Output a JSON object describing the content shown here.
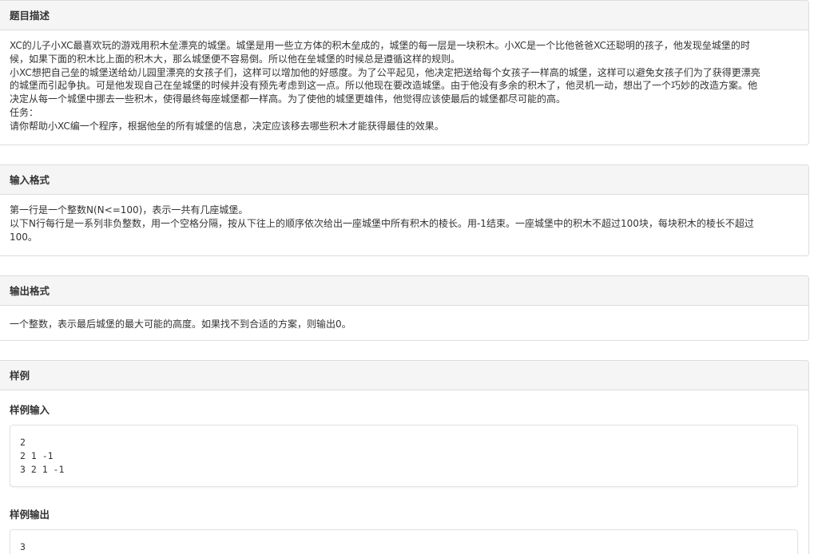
{
  "description": {
    "heading": "题目描述",
    "lines": [
      "XC的儿子小XC最喜欢玩的游戏用积木垒漂亮的城堡。城堡是用一些立方体的积木垒成的，城堡的每一层是一块积木。小XC是一个比他爸爸XC还聪明的孩子，他发现垒城堡的时",
      "候，如果下面的积木比上面的积木大，那么城堡便不容易倒。所以他在垒城堡的时候总是遵循这样的规则。",
      "小XC想把自己垒的城堡送给幼儿园里漂亮的女孩子们，这样可以增加他的好感度。为了公平起见，他决定把送给每个女孩子一样高的城堡，这样可以避免女孩子们为了获得更漂亮",
      "的城堡而引起争执。可是他发现自己在垒城堡的时候并没有预先考虑到这一点。所以他现在要改造城堡。由于他没有多余的积木了，他灵机一动，想出了一个巧妙的改造方案。他",
      "决定从每一个城堡中挪去一些积木，使得最终每座城堡都一样高。为了使他的城堡更雄伟，他觉得应该使最后的城堡都尽可能的高。",
      "任务：",
      "请你帮助小XC编一个程序，根据他垒的所有城堡的信息，决定应该移去哪些积木才能获得最佳的效果。"
    ]
  },
  "input_format": {
    "heading": "输入格式",
    "lines": [
      "第一行是一个整数N(N<=100)，表示一共有几座城堡。",
      "以下N行每行是一系列非负整数，用一个空格分隔，按从下往上的顺序依次给出一座城堡中所有积木的棱长。用-1结束。一座城堡中的积木不超过100块，每块积木的棱长不超过",
      "100。"
    ]
  },
  "output_format": {
    "heading": "输出格式",
    "lines": [
      "一个整数，表示最后城堡的最大可能的高度。如果找不到合适的方案，则输出0。"
    ]
  },
  "sample": {
    "heading": "样例",
    "input_title": "样例输入",
    "input_lines": [
      "2",
      "2 1 -1",
      "3 2 1 -1"
    ],
    "output_title": "样例输出",
    "output_lines": [
      "3"
    ]
  }
}
